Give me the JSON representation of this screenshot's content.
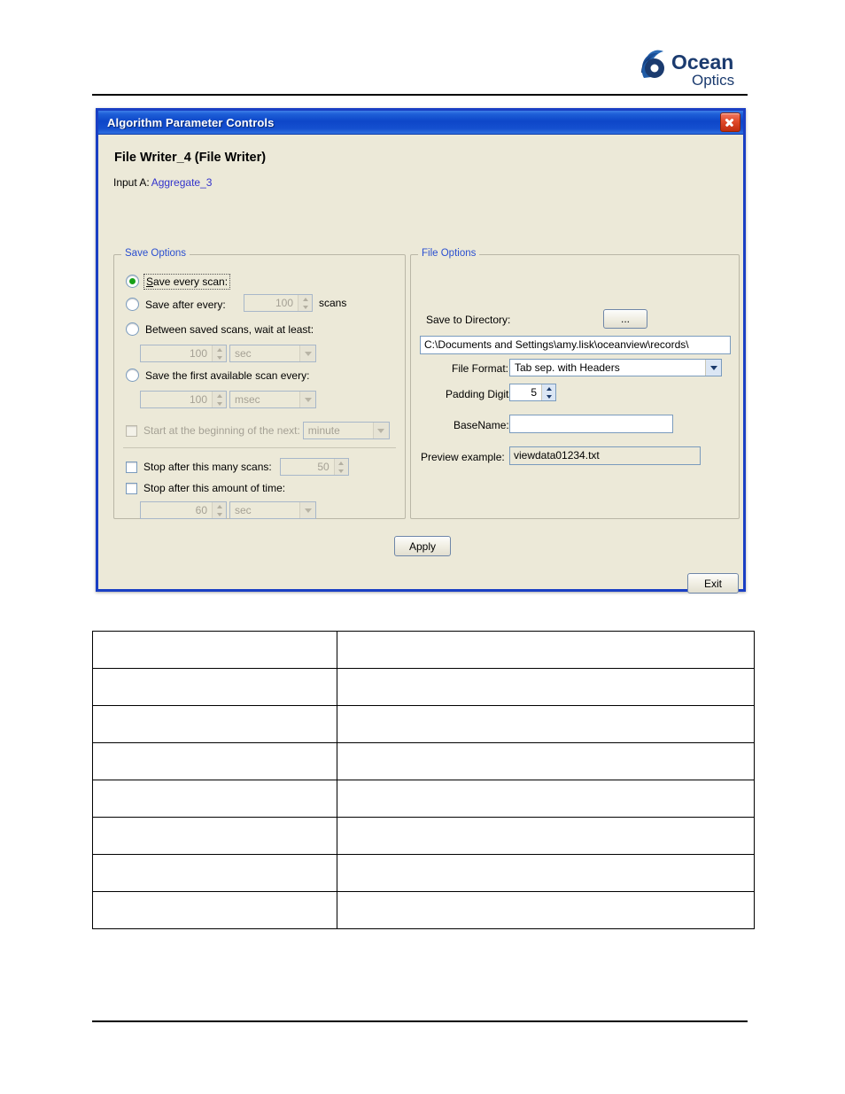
{
  "document": {
    "logo": {
      "brand_top": "Ocean",
      "brand_bottom": "Optics",
      "mark": "shell-spiral-icon"
    }
  },
  "dialog": {
    "titlebar": {
      "title": "Algorithm Parameter Controls",
      "close_icon": "close-icon"
    },
    "heading": "File Writer_4 (File Writer)",
    "input_label": "Input A:",
    "input_value": "Aggregate_3",
    "save_options": {
      "title": "Save Options",
      "radios": [
        {
          "label": "Save every scan:",
          "selected": true,
          "focused": true
        },
        {
          "label": "Save after every:",
          "selected": false
        },
        {
          "label": "Between saved scans, wait at least:",
          "selected": false
        },
        {
          "label": "Save the first available scan every:",
          "selected": false
        }
      ],
      "save_after_every_value": "100",
      "save_after_every_suffix": "scans",
      "wait_at_least_value": "100",
      "wait_at_least_unit": "sec",
      "first_available_value": "100",
      "first_available_unit": "msec",
      "start_beginning_label": "Start at the beginning of the next:",
      "start_beginning_unit": "minute",
      "start_beginning_checked": false,
      "stop_scans_label": "Stop after this many scans:",
      "stop_scans_value": "50",
      "stop_scans_checked": false,
      "stop_time_label": "Stop after this amount of time:",
      "stop_time_value": "60",
      "stop_time_unit": "sec",
      "stop_time_checked": false
    },
    "file_options": {
      "title": "File Options",
      "save_to_directory_label": "Save to Directory:",
      "browse_button_label": "...",
      "directory_value": "C:\\Documents and Settings\\amy.lisk\\oceanview\\records\\",
      "file_format_label": "File Format:",
      "file_format_value": "Tab sep. with Headers",
      "padding_digits_label": "Padding Digits:",
      "padding_digits_value": "5",
      "basename_label": "BaseName:",
      "basename_value": "",
      "preview_label": "Preview example:",
      "preview_value": "viewdata01234.txt"
    },
    "apply_button": "Apply",
    "exit_button": "Exit"
  },
  "table": {
    "rows": [
      {
        "c1": "",
        "c2": ""
      },
      {
        "c1": "",
        "c2": ""
      },
      {
        "c1": "",
        "c2": ""
      },
      {
        "c1": "",
        "c2": ""
      },
      {
        "c1": "",
        "c2": ""
      },
      {
        "c1": "",
        "c2": ""
      },
      {
        "c1": "",
        "c2": ""
      },
      {
        "c1": "",
        "c2": ""
      }
    ]
  },
  "colors": {
    "title_blue": "#0d46c8",
    "dialog_border": "#1a3fc4",
    "dialog_face": "#ece9d8",
    "group_title": "#2a4fd0",
    "link": "#3333cc",
    "radio_dot": "#18a018",
    "close_red": "#c02c0e",
    "brand_blue": "#1b3b6f"
  }
}
